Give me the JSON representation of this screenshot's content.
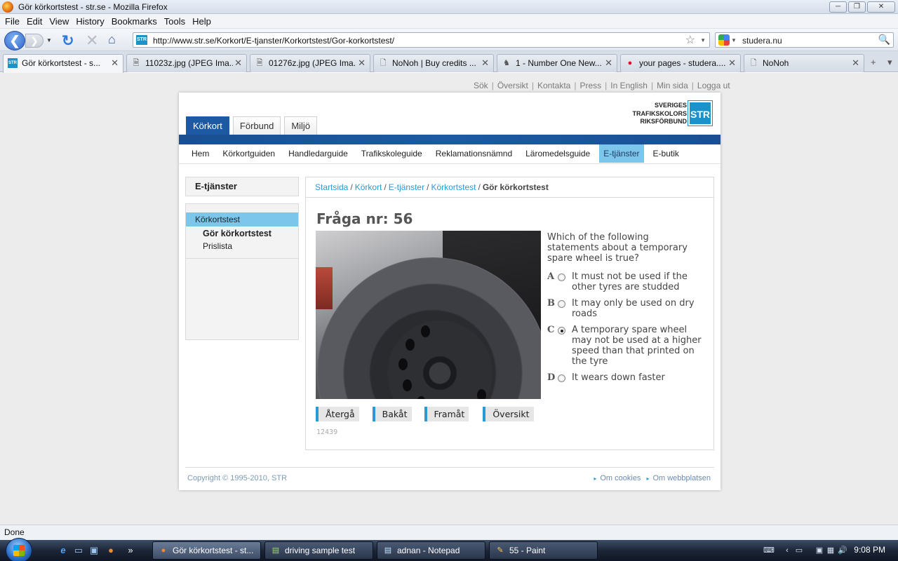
{
  "window": {
    "title": "Gör körkortstest - str.se - Mozilla Firefox",
    "controls": [
      "─",
      "❐",
      "✕"
    ]
  },
  "menubar": {
    "items": [
      "File",
      "Edit",
      "View",
      "History",
      "Bookmarks",
      "Tools",
      "Help"
    ]
  },
  "navbar": {
    "back": "❮",
    "forward": "❯",
    "forward_dropdown": "▼",
    "reload": "↻",
    "stop": "✕",
    "home": "⌂",
    "url": "http://www.str.se/Korkort/E-tjanster/Korkortstest/Gor-korkortstest/",
    "url_favicon": "STR",
    "star": "☆",
    "url_dropdown": "▼",
    "search_value": "studera.nu",
    "search_dropdown": "▼",
    "search_icon": "🔍"
  },
  "tabs": [
    {
      "label": "Gör körkortstest - s...",
      "icon": "STR",
      "close": "✕",
      "active": true
    },
    {
      "label": "11023z.jpg (JPEG Ima...",
      "icon": "🗎",
      "close": "✕"
    },
    {
      "label": "01276z.jpg (JPEG Ima...",
      "icon": "🗎",
      "close": "✕"
    },
    {
      "label": "NoNoh | Buy credits ...",
      "icon": "🗋",
      "close": "✕"
    },
    {
      "label": "1 - Number One New...",
      "icon": "♞",
      "close": "✕"
    },
    {
      "label": "your pages - studera....",
      "icon": "●",
      "close": "✕"
    },
    {
      "label": "NoNoh",
      "icon": "🗋",
      "close": "✕"
    }
  ],
  "tabbar_controls": {
    "new_tab": "+",
    "list": "▾"
  },
  "site": {
    "top_links": [
      "Sök",
      "Översikt",
      "Kontakta",
      "Press",
      "In English",
      "Min sida",
      "Logga ut"
    ],
    "top_links_sep": "|",
    "main_tabs": [
      "Körkort",
      "Förbund",
      "Miljö"
    ],
    "logo": {
      "line1": "SVERIGES",
      "line2": "TRAFIKSKOLORS",
      "line3": "RIKSFÖRBUND",
      "mark": "STR"
    },
    "subnav": [
      "Hem",
      "Körkortguiden",
      "Handledarguide",
      "Trafikskoleguide",
      "Reklamationsnämnd",
      "Läromedelsguide",
      "E-tjänster",
      "E-butik"
    ],
    "subnav_active_index": 6,
    "sidebar": {
      "heading": "E-tjänster",
      "items": [
        "Körkortstest",
        "Gör körkortstest",
        "Prislista"
      ]
    },
    "breadcrumb": {
      "items": [
        "Startsida",
        "Körkort",
        "E-tjänster",
        "Körkortstest"
      ],
      "current": "Gör körkortstest",
      "sep": "/"
    },
    "question": {
      "title": "Fråga nr: 56",
      "text": "Which of the following statements about a temporary spare wheel is true?",
      "options": [
        {
          "letter": "A",
          "text": "It must not be used if the other tyres are studded",
          "checked": false
        },
        {
          "letter": "B",
          "text": "It may only be used on dry roads",
          "checked": false
        },
        {
          "letter": "C",
          "text": "A temporary spare wheel may not be used at a higher speed than that printed on the tyre",
          "checked": true
        },
        {
          "letter": "D",
          "text": "It wears down faster",
          "checked": false
        }
      ],
      "buttons": [
        "Återgå",
        "Bakåt",
        "Framåt",
        "Översikt"
      ],
      "code": "12439"
    },
    "footer": {
      "copyright": "Copyright © 1995-2010, STR",
      "links": [
        "Om cookies",
        "Om webbplatsen"
      ],
      "link_arrow": "▸"
    }
  },
  "statusbar": {
    "text": "Done"
  },
  "taskbar": {
    "quick_launch": [
      "e",
      "▭",
      "▣",
      "●",
      "»"
    ],
    "buttons": [
      {
        "label": "Gör körkortstest - st...",
        "icon": "●",
        "active": true
      },
      {
        "label": "driving sample test",
        "icon": "▤"
      },
      {
        "label": "adnan - Notepad",
        "icon": "▤"
      },
      {
        "label": "55 - Paint",
        "icon": "✎"
      }
    ],
    "tray_icons": [
      "⌨",
      "‹",
      "▭",
      "▣",
      "▦",
      "🔊"
    ],
    "clock": "9:08 PM"
  },
  "colors": {
    "accent_blue": "#1d5aa3",
    "light_blue": "#7cc6ec",
    "link_blue": "#2a9ad4",
    "str_logo": "#1b92c9"
  }
}
